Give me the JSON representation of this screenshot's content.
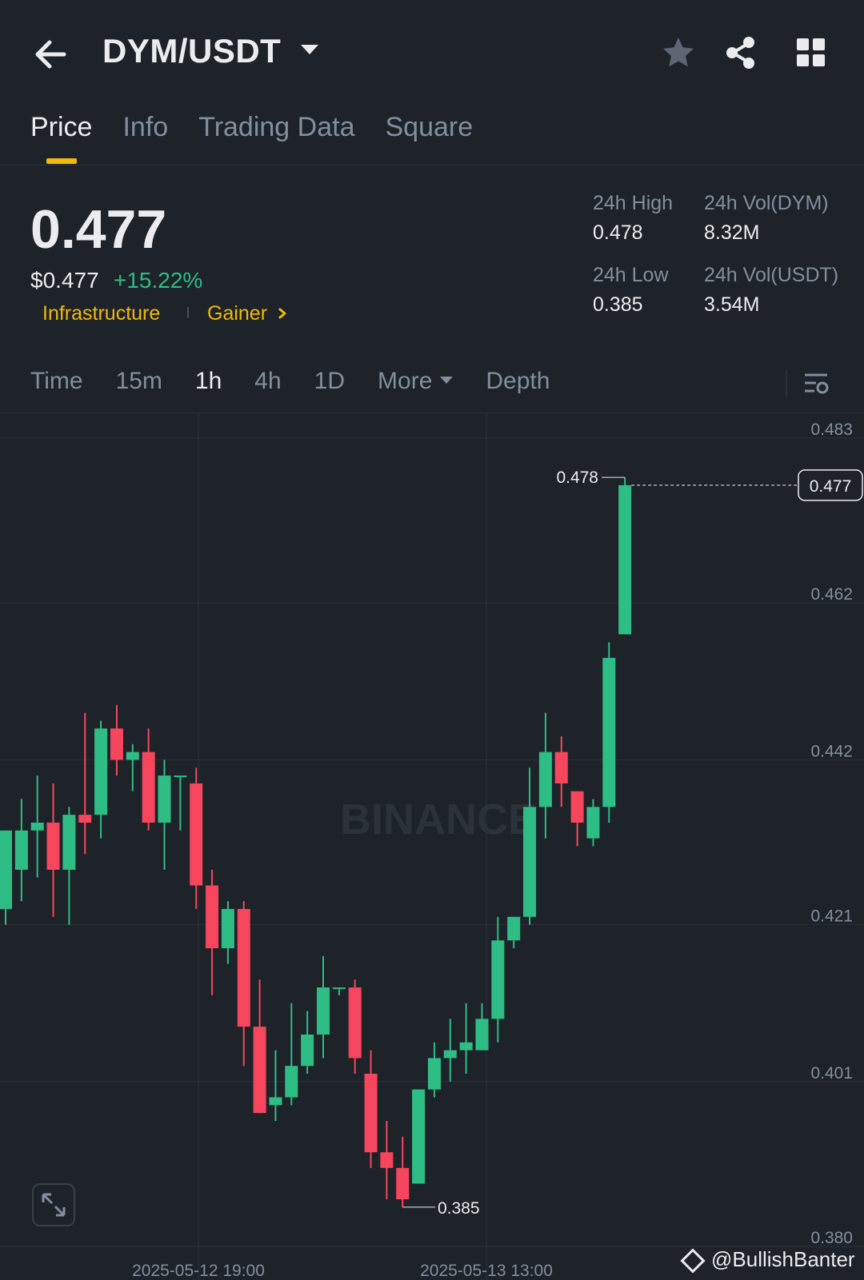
{
  "header": {
    "pair": "DYM/USDT",
    "icons": [
      "back-arrow-icon",
      "chevron-down-icon",
      "star-icon",
      "share-icon",
      "grid-icon"
    ]
  },
  "tabs": [
    {
      "label": "Price",
      "active": true
    },
    {
      "label": "Info",
      "active": false
    },
    {
      "label": "Trading Data",
      "active": false
    },
    {
      "label": "Square",
      "active": false
    }
  ],
  "ticker": {
    "price": "0.477",
    "usd_price": "$0.477",
    "change": "+15.22%",
    "tag_category": "Infrastructure",
    "tag_status": "Gainer",
    "stats": {
      "high_label": "24h High",
      "high_value": "0.478",
      "low_label": "24h Low",
      "low_value": "0.385",
      "vol_base_label": "24h Vol(DYM)",
      "vol_base_value": "8.32M",
      "vol_quote_label": "24h Vol(USDT)",
      "vol_quote_value": "3.54M"
    }
  },
  "intervals": {
    "items": [
      "Time",
      "15m",
      "1h",
      "4h",
      "1D"
    ],
    "active": "1h",
    "more": "More",
    "depth": "Depth"
  },
  "colors": {
    "background": "#1e2329",
    "up": "#2ebd85",
    "down": "#f6465d",
    "accent": "#f0b90b",
    "muted": "#848e9c"
  },
  "chart_data": {
    "type": "candlestick",
    "interval": "1h",
    "y_ticks": [
      0.483,
      0.462,
      0.442,
      0.421,
      0.401,
      0.38
    ],
    "ylim": [
      0.38,
      0.483
    ],
    "x_ticks": [
      "2025-05-12 19:00",
      "2025-05-13 13:00"
    ],
    "current_price": "0.477",
    "high_marker": "0.478",
    "low_marker": "0.385",
    "watermark": "BINANCE",
    "grid": true,
    "candles": [
      [
        0.423,
        0.433,
        0.421,
        0.433
      ],
      [
        0.428,
        0.437,
        0.424,
        0.433
      ],
      [
        0.433,
        0.44,
        0.427,
        0.434
      ],
      [
        0.434,
        0.439,
        0.422,
        0.428
      ],
      [
        0.428,
        0.436,
        0.421,
        0.435
      ],
      [
        0.435,
        0.448,
        0.43,
        0.434
      ],
      [
        0.435,
        0.447,
        0.432,
        0.446
      ],
      [
        0.446,
        0.449,
        0.44,
        0.442
      ],
      [
        0.442,
        0.444,
        0.438,
        0.443
      ],
      [
        0.443,
        0.446,
        0.433,
        0.434
      ],
      [
        0.434,
        0.442,
        0.428,
        0.44
      ],
      [
        0.44,
        0.44,
        0.433,
        0.44
      ],
      [
        0.439,
        0.441,
        0.423,
        0.426
      ],
      [
        0.426,
        0.428,
        0.412,
        0.418
      ],
      [
        0.418,
        0.424,
        0.416,
        0.423
      ],
      [
        0.423,
        0.424,
        0.403,
        0.408
      ],
      [
        0.408,
        0.414,
        0.397,
        0.397
      ],
      [
        0.398,
        0.405,
        0.396,
        0.399
      ],
      [
        0.399,
        0.411,
        0.398,
        0.403
      ],
      [
        0.403,
        0.41,
        0.402,
        0.407
      ],
      [
        0.407,
        0.417,
        0.404,
        0.413
      ],
      [
        0.413,
        0.413,
        0.412,
        0.413
      ],
      [
        0.413,
        0.414,
        0.402,
        0.404
      ],
      [
        0.402,
        0.405,
        0.39,
        0.392
      ],
      [
        0.392,
        0.396,
        0.386,
        0.39
      ],
      [
        0.39,
        0.394,
        0.385,
        0.386
      ],
      [
        0.388,
        0.399,
        0.388,
        0.4
      ],
      [
        0.4,
        0.406,
        0.399,
        0.404
      ],
      [
        0.404,
        0.409,
        0.401,
        0.405
      ],
      [
        0.405,
        0.411,
        0.402,
        0.406
      ],
      [
        0.405,
        0.411,
        0.405,
        0.409
      ],
      [
        0.409,
        0.422,
        0.406,
        0.419
      ],
      [
        0.419,
        0.422,
        0.418,
        0.422
      ],
      [
        0.422,
        0.441,
        0.421,
        0.436
      ],
      [
        0.436,
        0.448,
        0.432,
        0.443
      ],
      [
        0.443,
        0.445,
        0.436,
        0.439
      ],
      [
        0.438,
        0.438,
        0.431,
        0.434
      ],
      [
        0.432,
        0.437,
        0.431,
        0.436
      ],
      [
        0.436,
        0.457,
        0.434,
        0.455
      ],
      [
        0.458,
        0.478,
        0.458,
        0.477
      ]
    ]
  },
  "footer": {
    "watermark": "@BullishBanter"
  }
}
